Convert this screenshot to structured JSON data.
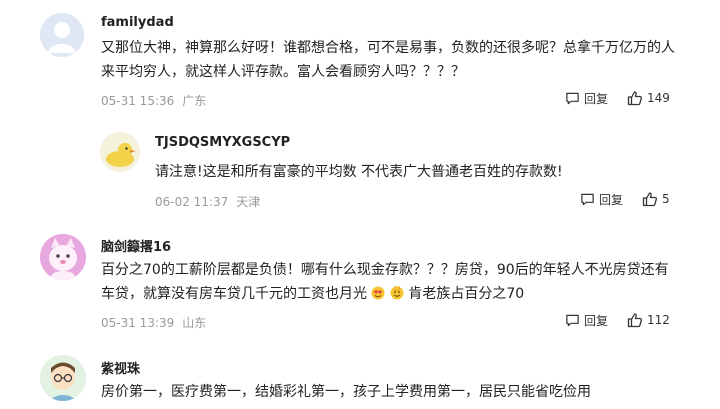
{
  "comments": [
    {
      "username": "familydad",
      "content": "又那位大神，神算那么好呀！谁都想合格，可不是易事，负数的还很多呢？总拿千万亿万的人来平均穷人，就这样人评存款。富人会看顾穷人吗？？？？",
      "time": "05-31 15:36",
      "location": "广东",
      "reply_label": "回复",
      "likes": "149"
    },
    {
      "username": "TJSDQSMYXGSCYP",
      "content": "请注意!这是和所有富豪的平均数 不代表广大普通老百姓的存款数!",
      "time": "06-02 11:37",
      "location": "天津",
      "reply_label": "回复",
      "likes": "5"
    },
    {
      "username": "脑剑籙撂16",
      "content_a": "百分之70的工薪阶层都是负债！哪有什么现金存款？？？房贷，90后的年轻人不光房贷还有车贷，就算没有房车贷几千元的工资也月光",
      "content_b": "肯老族占百分之70",
      "time": "05-31 13:39",
      "location": "山东",
      "reply_label": "回复",
      "likes": "112"
    },
    {
      "username": "紫视珠",
      "content": "房价第一，医疗费第一，结婚彩礼第一，孩子上学费用第一，居民只能省吃俭用"
    }
  ],
  "icons": {
    "reply": "reply-icon",
    "like": "thumbs-up-icon"
  },
  "colors": {
    "meta": "#999999",
    "text": "#222222"
  }
}
